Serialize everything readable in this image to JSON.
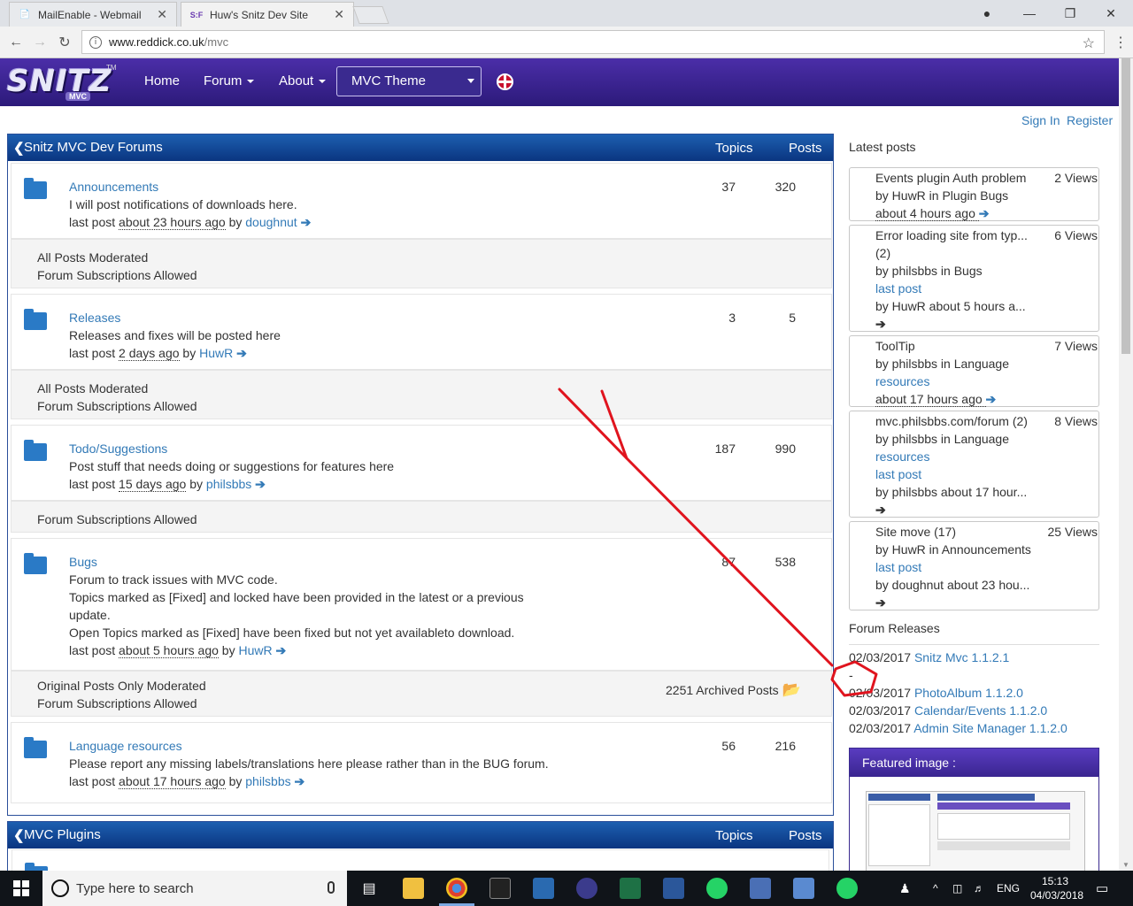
{
  "browser": {
    "tabs": [
      {
        "title": "MailEnable - Webmail",
        "icon": "document-icon"
      },
      {
        "title": "Huw's Snitz Dev Site",
        "icon": "snitz-favicon"
      }
    ],
    "url_host": "www.reddick.co.uk",
    "url_path": "/mvc"
  },
  "site": {
    "logo_text": "SNITZ",
    "logo_sub": "MVC",
    "logo_tm": "TM",
    "nav": {
      "home": "Home",
      "forum": "Forum",
      "about": "About"
    },
    "theme_select": "MVC Theme",
    "sign_in": "Sign In",
    "register": "Register"
  },
  "forums_panel": {
    "title": "Snitz MVC Dev Forums",
    "col_topics": "Topics",
    "col_posts": "Posts",
    "forums": [
      {
        "name": "Announcements",
        "desc": [
          "I will post notifications of downloads here."
        ],
        "last_post_label": "last post",
        "last_post_time": "about 23 hours ago",
        "by": "by",
        "author": "doughnut",
        "topics": "37",
        "posts": "320",
        "info": [
          "All Posts Moderated",
          "Forum Subscriptions Allowed"
        ]
      },
      {
        "name": "Releases",
        "desc": [
          "Releases and fixes will be posted here"
        ],
        "last_post_label": "last post",
        "last_post_time": "2 days ago",
        "by": "by",
        "author": "HuwR",
        "topics": "3",
        "posts": "5",
        "info": [
          "All Posts Moderated",
          "Forum Subscriptions Allowed"
        ]
      },
      {
        "name": "Todo/Suggestions",
        "desc": [
          "Post stuff that needs doing or suggestions for features here"
        ],
        "last_post_label": "last post",
        "last_post_time": "15 days ago",
        "by": "by",
        "author": "philsbbs",
        "topics": "187",
        "posts": "990",
        "info": [
          "Forum Subscriptions Allowed"
        ]
      },
      {
        "name": "Bugs",
        "desc": [
          "Forum to track issues with MVC code.",
          "Topics marked as [Fixed] and locked have been provided in the latest or a previous",
          "update.",
          "Open Topics marked as [Fixed] have been fixed but not yet availableto download."
        ],
        "last_post_label": "last post",
        "last_post_time": "about 5 hours ago",
        "by": "by",
        "author": "HuwR",
        "topics": "87",
        "posts": "538",
        "info": [
          "Original Posts Only Moderated",
          "Forum Subscriptions Allowed"
        ],
        "archived": "2251 Archived Posts"
      },
      {
        "name": "Language resources",
        "desc": [
          "Please report any missing labels/translations here please rather than in the BUG forum."
        ],
        "last_post_label": "last post",
        "last_post_time": "about 17 hours ago",
        "by": "by",
        "author": "philsbbs",
        "topics": "56",
        "posts": "216"
      }
    ]
  },
  "plugins_panel": {
    "title": "MVC Plugins",
    "col_topics": "Topics",
    "col_posts": "Posts"
  },
  "sidebar": {
    "latest_title": "Latest posts",
    "posts": [
      {
        "lines": [
          "Events plugin Auth problem",
          "by HuwR in Plugin Bugs",
          " about 4 hours ago "
        ],
        "views": "2 Views"
      },
      {
        "lines": [
          "Error loading site from typ...",
          "(2)",
          "by philsbbs in Bugs",
          "last post",
          "by HuwR about 5 hours a..."
        ],
        "views": "6 Views"
      },
      {
        "lines": [
          "ToolTip",
          "by philsbbs in Language",
          "resources",
          " about 17 hours ago "
        ],
        "views": "7 Views"
      },
      {
        "lines": [
          "mvc.philsbbs.com/forum (2)",
          "by philsbbs in Language",
          "resources",
          "last post",
          "by philsbbs about 17 hour..."
        ],
        "views": "8 Views"
      },
      {
        "lines": [
          "Site move (17)",
          "by HuwR in Announcements",
          "last post",
          "by doughnut about 23 hou..."
        ],
        "views": "25 Views"
      }
    ],
    "releases_title": "Forum Releases",
    "releases": [
      {
        "date": "02/03/2017",
        "name": "Snitz Mvc 1.1.2.1"
      },
      {
        "date": "-",
        "name": ""
      },
      {
        "date": "02/03/2017",
        "name": "PhotoAlbum 1.1.2.0"
      },
      {
        "date": "02/03/2017",
        "name": "Calendar/Events 1.1.2.0"
      },
      {
        "date": "02/03/2017",
        "name": "Admin Site Manager 1.1.2.0"
      }
    ],
    "featured_title": "Featured image :"
  },
  "taskbar": {
    "search_placeholder": "Type here to search",
    "lang": "ENG",
    "time": "15:13",
    "date": "04/03/2018"
  },
  "colors": {
    "nav_bg": "#3a2590",
    "panel_head": "#0f4a98",
    "link": "#337ab7",
    "annotation": "#e0141e"
  }
}
